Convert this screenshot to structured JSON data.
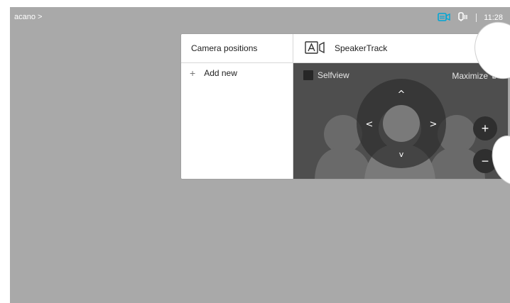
{
  "topbar": {
    "device_name": "acano >",
    "time": "11:28",
    "icons": [
      "camera-share-icon",
      "microphone-icon"
    ],
    "accent_color": "#00a6d6"
  },
  "panel": {
    "left": {
      "title": "Camera positions",
      "add_label": "Add new"
    },
    "right": {
      "speakertrack_label": "SpeakerTrack",
      "selfview_label": "Selfview",
      "maximize_label": "Maximize"
    },
    "controls": {
      "up": "^",
      "down": "v",
      "left": "<",
      "right": ">",
      "zoom_in": "+",
      "zoom_out": "−"
    }
  }
}
